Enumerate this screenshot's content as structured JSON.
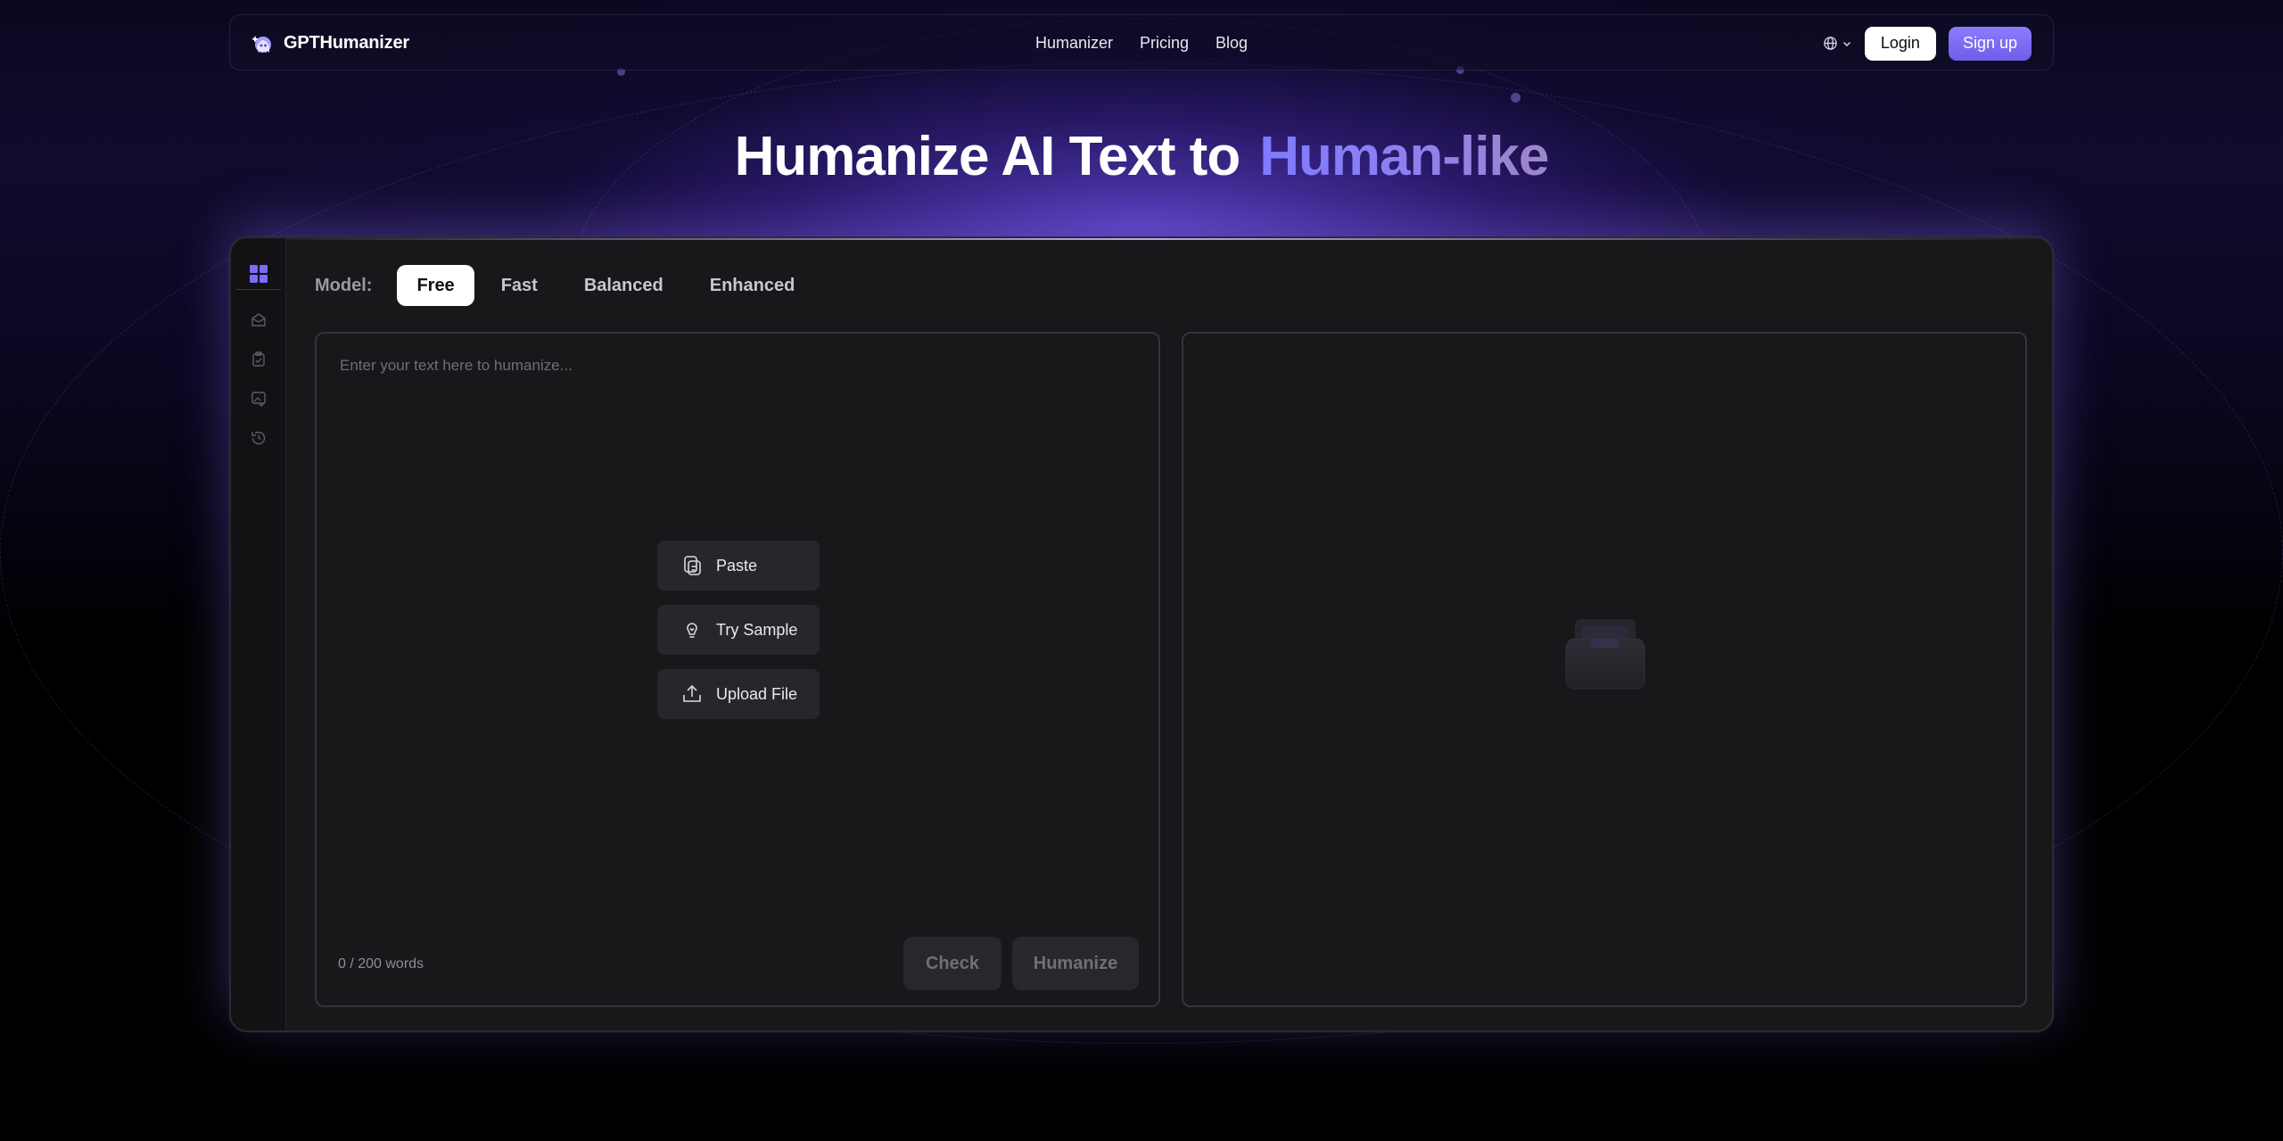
{
  "brand": {
    "name": "GPTHumanizer"
  },
  "nav": {
    "links": [
      "Humanizer",
      "Pricing",
      "Blog"
    ],
    "login_label": "Login",
    "signup_label": "Sign up"
  },
  "hero": {
    "title_main": "Humanize AI Text to",
    "title_accent": "Human-like"
  },
  "model": {
    "label": "Model:",
    "tabs": [
      "Free",
      "Fast",
      "Balanced",
      "Enhanced"
    ],
    "selected": "Free"
  },
  "editor": {
    "placeholder": "Enter your text here to humanize...",
    "value": "",
    "paste_label": "Paste",
    "sample_label": "Try Sample",
    "upload_label": "Upload File",
    "word_count": "0 / 200 words",
    "check_label": "Check",
    "humanize_label": "Humanize"
  },
  "sidebar": {
    "items": [
      "grid-icon",
      "mail-icon",
      "clipboard-check-icon",
      "image-check-icon",
      "history-icon"
    ]
  },
  "colors": {
    "accent": "#7f7bff",
    "signup": "#6e5ee8",
    "panel_bg": "#18181b"
  }
}
